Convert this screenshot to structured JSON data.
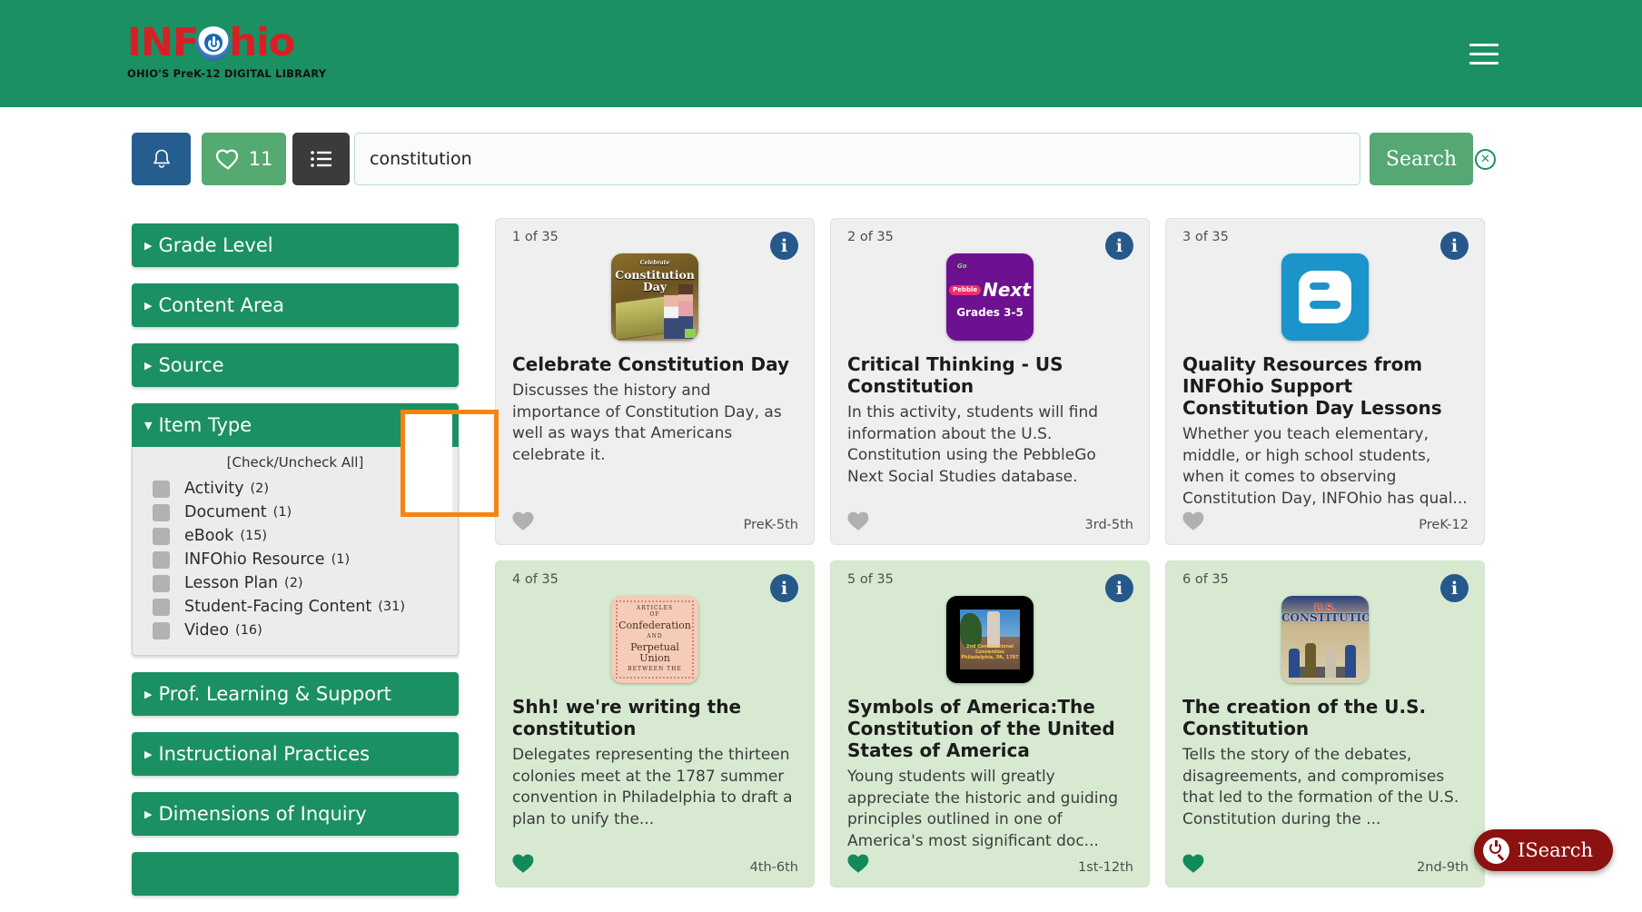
{
  "header": {
    "logo_word_1": "INF",
    "logo_word_2": "hio",
    "logo_tagline": "OHIO'S PreK-12 DIGITAL LIBRARY",
    "menu_icon": "hamburger-menu-icon",
    "brand_green": "#1b9063",
    "brand_red": "#d91f26"
  },
  "toolbar": {
    "alerts_icon": "bell-icon",
    "favorites_icon": "heart-outline-icon",
    "favorites_count": "11",
    "list_icon": "list-view-icon",
    "search_value": "constitution",
    "search_placeholder": "Search",
    "search_button": "Search",
    "clear_icon": "clear-circle-x-icon"
  },
  "sidebar": {
    "facets": [
      {
        "label": "Grade Level",
        "expanded": false
      },
      {
        "label": "Content Area",
        "expanded": false
      },
      {
        "label": "Source",
        "expanded": false
      },
      {
        "label": "Item Type",
        "expanded": true
      },
      {
        "label": "Prof. Learning & Support",
        "expanded": false
      },
      {
        "label": "Instructional Practices",
        "expanded": false
      },
      {
        "label": "Dimensions of Inquiry",
        "expanded": false
      }
    ],
    "item_type": {
      "check_all": "[Check/Uncheck All]",
      "options": [
        {
          "label": "Activity",
          "count": "(2)",
          "checked": false
        },
        {
          "label": "Document",
          "count": "(1)",
          "checked": false
        },
        {
          "label": "eBook",
          "count": "(15)",
          "checked": false
        },
        {
          "label": "INFOhio Resource",
          "count": "(1)",
          "checked": false
        },
        {
          "label": "Lesson Plan",
          "count": "(2)",
          "checked": false
        },
        {
          "label": "Student-Facing Content",
          "count": "(31)",
          "checked": false
        },
        {
          "label": "Video",
          "count": "(16)",
          "checked": false
        }
      ]
    }
  },
  "results": {
    "cards": [
      {
        "index": "1 of 35",
        "title": "Celebrate Constitution Day",
        "description": "Discusses the history and importance of Constitution Day, as well as ways that Americans celebrate it.",
        "grades": "PreK-5th",
        "saved": false,
        "thumb": "constitution-day-book-cover",
        "thumb_text_1": "Celebrate",
        "thumb_text_2": "Constitution",
        "thumb_text_3": "Day"
      },
      {
        "index": "2 of 35",
        "title": "Critical Thinking - US Constitution",
        "description": "In this activity, students will find information about the U.S. Constitution using the PebbleGo Next Social Studies database.",
        "grades": "3rd-5th",
        "saved": false,
        "thumb": "pebblego-next-logo",
        "thumb_text_1": "Pebble",
        "thumb_text_2": "Go",
        "thumb_text_3": "Next",
        "thumb_text_4": "Grades 3-5"
      },
      {
        "index": "3 of 35",
        "title": "Quality Resources from INFOhio Support Constitution Day Lessons",
        "description": "Whether you teach elementary, middle, or high school students, when it comes to observing Constitution Day, INFOhio has qual...",
        "grades": "PreK-12",
        "saved": false,
        "thumb": "blogger-logo-icon"
      },
      {
        "index": "4 of 35",
        "title": "Shh! we're writing the constitution",
        "description": "Delegates representing the thirteen colonies meet at the 1787 summer convention in Philadelphia to draft a plan to unify the...",
        "grades": "4th-6th",
        "saved": true,
        "thumb": "articles-of-confederation-cover",
        "thumb_text_1": "ARTICLES",
        "thumb_text_2": "OF",
        "thumb_text_3": "Confederation",
        "thumb_text_4": "AND",
        "thumb_text_5": "Perpetual Union",
        "thumb_text_6": "BETWEEN THE"
      },
      {
        "index": "5 of 35",
        "title": "Symbols of America:The Constitution of the United States of America",
        "description": "Young students will greatly appreciate the historic and guiding principles outlined in one of America's most significant doc...",
        "grades": "1st-12th",
        "saved": true,
        "thumb": "video-thumbnail-independence-hall",
        "thumb_text_1": "2nd Constitutional Convention",
        "thumb_text_2": "Philadelphia, PA, 1787"
      },
      {
        "index": "6 of 35",
        "title": "The creation of the U.S. Constitution",
        "description": "Tells the story of the debates, disagreements, and compromises that led to the formation of the U.S. Constitution during the ...",
        "grades": "2nd-9th",
        "saved": true,
        "thumb": "us-constitution-book-cover",
        "thumb_text_1": "U.S.",
        "thumb_text_2": "CONSTITUTION"
      }
    ]
  },
  "floating": {
    "isearch_label": "ISearch",
    "isearch_icon": "isearch-power-magnifier-icon"
  },
  "annotation": {
    "highlight_color": "#f58410",
    "target": "favorite-heart-button-card-1"
  }
}
